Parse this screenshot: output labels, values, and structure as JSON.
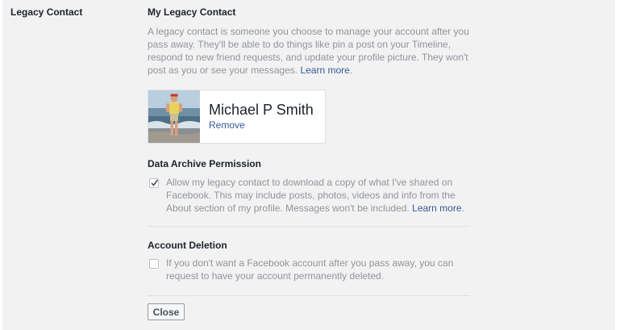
{
  "section": {
    "label": "Legacy Contact"
  },
  "legacy_contact": {
    "heading": "My Legacy Contact",
    "description": "A legacy contact is someone you choose to manage your account after you pass away. They'll be able to do things like pin a post on your Timeline, respond to new friend requests, and update your profile picture. They won't post as you or see your messages.",
    "learn_more": "Learn more",
    "contact": {
      "name": "Michael P Smith",
      "remove_label": "Remove"
    }
  },
  "data_archive": {
    "heading": "Data Archive Permission",
    "checked": true,
    "text": "Allow my legacy contact to download a copy of what I've shared on Facebook. This may include posts, photos, videos and info from the About section of my profile. Messages won't be included.",
    "learn_more": "Learn more"
  },
  "account_deletion": {
    "heading": "Account Deletion",
    "checked": false,
    "text": "If you don't want a Facebook account after you pass away, you can request to have your account permanently deleted."
  },
  "actions": {
    "close_label": "Close"
  },
  "colors": {
    "link": "#365899",
    "muted_text": "#90949c",
    "background": "#f2f2f2"
  }
}
